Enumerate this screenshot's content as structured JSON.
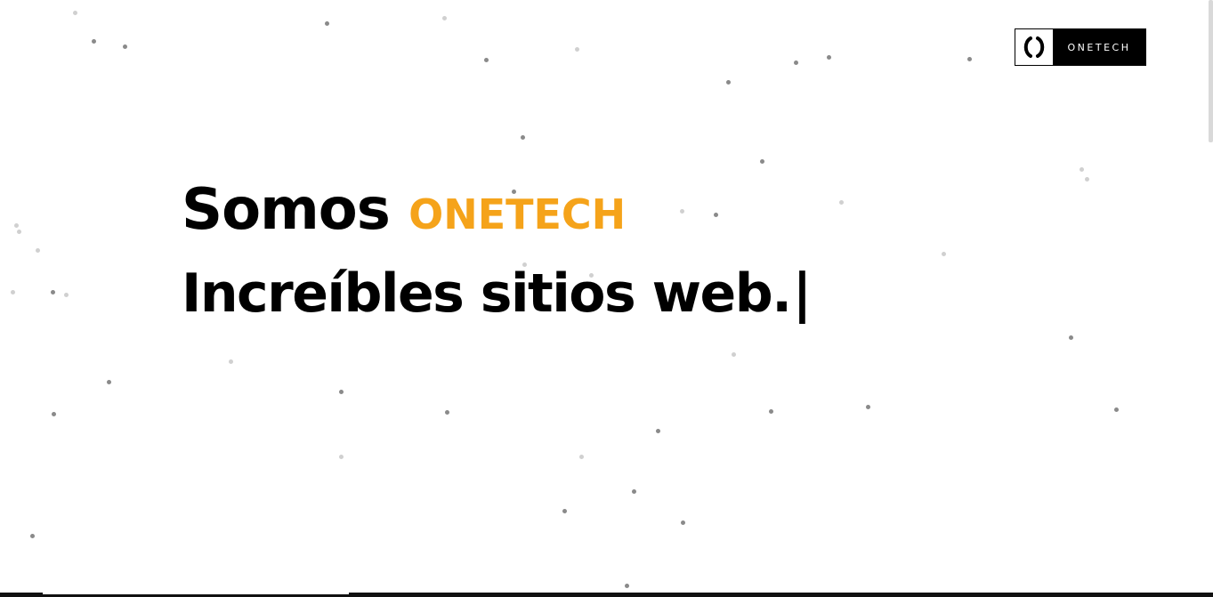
{
  "logo": {
    "icon": "parentheses-logo-icon",
    "text": "ONETECH"
  },
  "hero": {
    "prefix": "Somos",
    "brand": "ONETECH",
    "tagline": "Increíbles sitios web.",
    "cursor": "|"
  },
  "colors": {
    "accent": "#f5a31a",
    "text": "#000000",
    "background": "#ffffff",
    "particle": "#8a8a8a"
  }
}
